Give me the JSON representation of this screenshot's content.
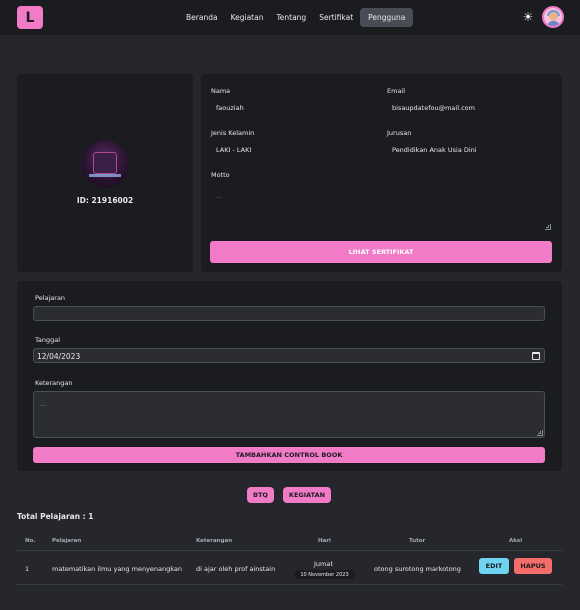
{
  "navbar": {
    "logo": "L",
    "links": [
      "Beranda",
      "Kegiatan",
      "Tentang",
      "Sertifikat",
      "Pengguna"
    ],
    "active_link": "Pengguna",
    "theme_icon": "sun-icon",
    "avatar_icon": "user-avatar"
  },
  "profile": {
    "id_label": "ID: 21916002"
  },
  "info": {
    "name_label": "Nama",
    "name_value": "faouziah",
    "email_label": "Email",
    "email_value": "bisaupdatefou@mail.com",
    "gender_label": "Jenis Kelamin",
    "gender_value": "LAKI - LAKI",
    "major_label": "Jurusan",
    "major_value": "Pendidikan Anak Usia Dini",
    "motto_label": "Motto",
    "motto_placeholder": "...",
    "certificate_button": "LIHAT SERTIFIKAT"
  },
  "form": {
    "lesson_label": "Pelajaran",
    "lesson_value": "",
    "date_label": "Tanggal",
    "date_value": "12/04/2023",
    "note_label": "Keterangan",
    "note_placeholder": "...",
    "add_button": "TAMBAHKAN CONTROL BOOK"
  },
  "filters": [
    "BTQ",
    "KEGIATAN"
  ],
  "total_label": "Total Pelajaran : 1",
  "table": {
    "headers": [
      "No.",
      "Pelajaran",
      "Keterangan",
      "Hari",
      "Tutor",
      "Aksi"
    ],
    "rows": [
      {
        "no": "1",
        "lesson": "matematikan ilmu yang menyenangkan",
        "note": "di ajar oleh prof ainstain",
        "day": "Jumat",
        "date": "10 November 2023",
        "tutor": "otong surotong markotong",
        "edit": "EDIT",
        "delete": "HAPUS"
      }
    ]
  },
  "colors": {
    "accent": "#f27bc8",
    "background": "#26272c",
    "card": "#1b1c20",
    "edit": "#6fd3f2",
    "delete": "#f56c68"
  }
}
